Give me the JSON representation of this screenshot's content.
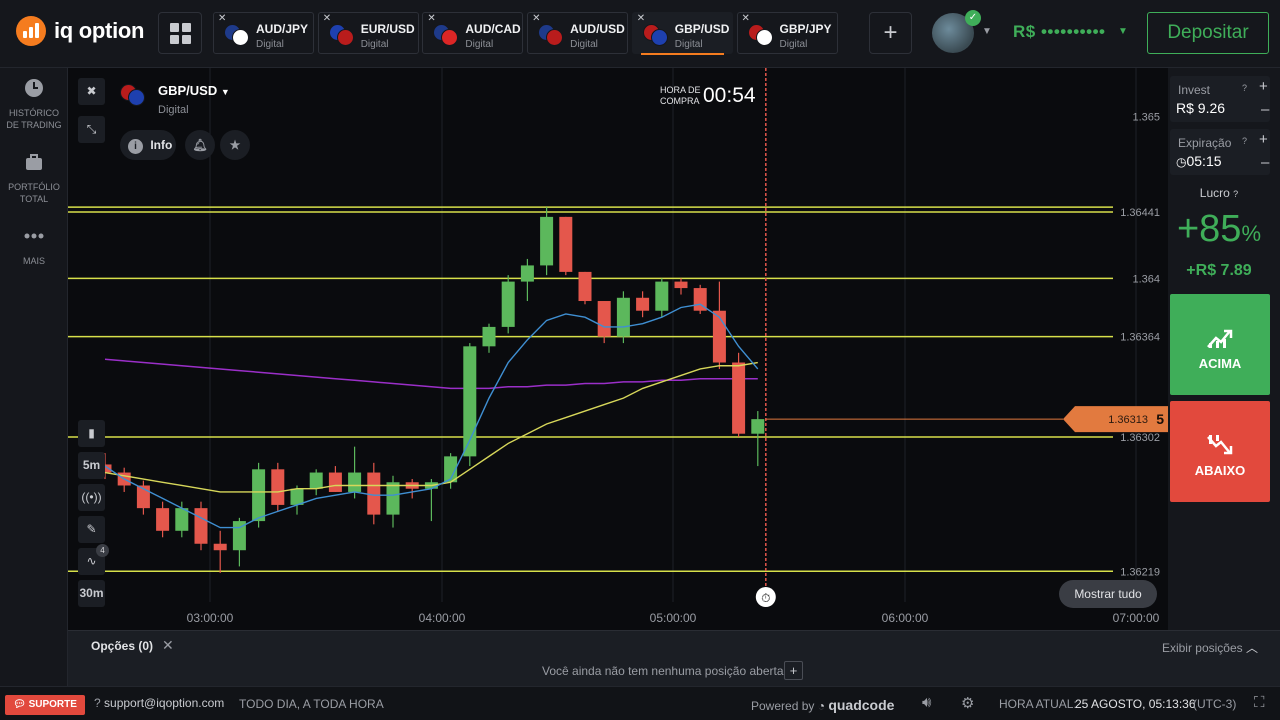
{
  "header": {
    "logo_text": "iq option",
    "tabs": [
      {
        "symbol": "AUD/JPY",
        "type": "Digital",
        "flag_a": "#1e3a8a",
        "flag_b": "#ffffff",
        "active": false
      },
      {
        "symbol": "EUR/USD",
        "type": "Digital",
        "flag_a": "#1e40af",
        "flag_b": "#b91c1c",
        "active": false
      },
      {
        "symbol": "AUD/CAD",
        "type": "Digital",
        "flag_a": "#1e3a8a",
        "flag_b": "#dc2626",
        "active": false
      },
      {
        "symbol": "AUD/USD",
        "type": "Digital",
        "flag_a": "#1e3a8a",
        "flag_b": "#b91c1c",
        "active": false
      },
      {
        "symbol": "GBP/USD",
        "type": "Digital",
        "flag_a": "#b91c1c",
        "flag_b": "#1e40af",
        "active": true
      },
      {
        "symbol": "GBP/JPY",
        "type": "Digital",
        "flag_a": "#b91c1c",
        "flag_b": "#ffffff",
        "active": false
      }
    ],
    "add_tab": "+",
    "balance": "R$ ••••••••••",
    "deposit": "Depositar"
  },
  "sidebar": {
    "items": [
      {
        "label_1": "HISTÓRICO",
        "label_2": "DE TRADING",
        "icon": "clock-icon"
      },
      {
        "label_1": "PORTFÓLIO",
        "label_2": "TOTAL",
        "icon": "briefcase-icon"
      },
      {
        "label_1": "MAIS",
        "label_2": "",
        "icon": "more-icon"
      }
    ]
  },
  "chart": {
    "asset": "GBP/USD",
    "asset_type": "Digital",
    "info_label": "Info",
    "hora_label_1": "HORA DE",
    "hora_label_2": "COMPRA",
    "timer": "00:54",
    "current_price_main": "1.36313",
    "current_price_tail": "5",
    "show_all": "Mostrar tudo",
    "timeframe": "5m",
    "period": "30m",
    "indicator_count": "4",
    "colors": {
      "up": "#5cb85c",
      "down": "#e4574c",
      "level": "#d7e04a",
      "ma_fast": "#3f8fd2",
      "ma_slow": "#d7d75a",
      "ma_long": "#9b2fc9",
      "cursor": "#e4574c"
    }
  },
  "chart_data": {
    "type": "candlestick",
    "y_ticks": [
      "1.365",
      "1.36441",
      "1.364",
      "1.36364",
      "1.36302",
      "1.36219"
    ],
    "x_ticks": [
      "03:00:00",
      "04:00:00",
      "05:00:00",
      "06:00:00",
      "07:00:00"
    ],
    "levels": [
      1.36444,
      1.36441,
      1.364,
      1.36364,
      1.36302,
      1.36219
    ],
    "ylim": [
      1.362,
      1.3653
    ],
    "xlim": [
      "02:30",
      "07:00"
    ],
    "candles": [
      {
        "o": 1.36285,
        "h": 1.36292,
        "l": 1.36276,
        "c": 1.3628
      },
      {
        "o": 1.3628,
        "h": 1.36283,
        "l": 1.36268,
        "c": 1.36272
      },
      {
        "o": 1.36272,
        "h": 1.36275,
        "l": 1.36254,
        "c": 1.36258
      },
      {
        "o": 1.36258,
        "h": 1.36262,
        "l": 1.3624,
        "c": 1.36244
      },
      {
        "o": 1.36244,
        "h": 1.36262,
        "l": 1.3624,
        "c": 1.36258
      },
      {
        "o": 1.36258,
        "h": 1.36262,
        "l": 1.36232,
        "c": 1.36236
      },
      {
        "o": 1.36236,
        "h": 1.36244,
        "l": 1.36218,
        "c": 1.36232
      },
      {
        "o": 1.36232,
        "h": 1.36252,
        "l": 1.36222,
        "c": 1.3625
      },
      {
        "o": 1.3625,
        "h": 1.36286,
        "l": 1.36246,
        "c": 1.36282
      },
      {
        "o": 1.36282,
        "h": 1.36286,
        "l": 1.36256,
        "c": 1.3626
      },
      {
        "o": 1.3626,
        "h": 1.36272,
        "l": 1.36254,
        "c": 1.3627
      },
      {
        "o": 1.3627,
        "h": 1.36282,
        "l": 1.36266,
        "c": 1.3628
      },
      {
        "o": 1.3628,
        "h": 1.36284,
        "l": 1.36268,
        "c": 1.36268
      },
      {
        "o": 1.36268,
        "h": 1.36296,
        "l": 1.36264,
        "c": 1.3628
      },
      {
        "o": 1.3628,
        "h": 1.36286,
        "l": 1.36248,
        "c": 1.36254
      },
      {
        "o": 1.36254,
        "h": 1.36278,
        "l": 1.36246,
        "c": 1.36274
      },
      {
        "o": 1.36274,
        "h": 1.36276,
        "l": 1.36264,
        "c": 1.3627
      },
      {
        "o": 1.3627,
        "h": 1.36276,
        "l": 1.3625,
        "c": 1.36274
      },
      {
        "o": 1.36274,
        "h": 1.36292,
        "l": 1.3627,
        "c": 1.3629
      },
      {
        "o": 1.3629,
        "h": 1.3636,
        "l": 1.36284,
        "c": 1.36358
      },
      {
        "o": 1.36358,
        "h": 1.36372,
        "l": 1.36354,
        "c": 1.3637
      },
      {
        "o": 1.3637,
        "h": 1.36402,
        "l": 1.36366,
        "c": 1.36398
      },
      {
        "o": 1.36398,
        "h": 1.36412,
        "l": 1.36386,
        "c": 1.36408
      },
      {
        "o": 1.36408,
        "h": 1.36444,
        "l": 1.36402,
        "c": 1.36438
      },
      {
        "o": 1.36438,
        "h": 1.36438,
        "l": 1.36402,
        "c": 1.36404
      },
      {
        "o": 1.36404,
        "h": 1.36404,
        "l": 1.36384,
        "c": 1.36386
      },
      {
        "o": 1.36386,
        "h": 1.36386,
        "l": 1.3636,
        "c": 1.36364
      },
      {
        "o": 1.36364,
        "h": 1.36392,
        "l": 1.3636,
        "c": 1.36388
      },
      {
        "o": 1.36388,
        "h": 1.36392,
        "l": 1.36376,
        "c": 1.3638
      },
      {
        "o": 1.3638,
        "h": 1.364,
        "l": 1.36376,
        "c": 1.36398
      },
      {
        "o": 1.36398,
        "h": 1.364,
        "l": 1.3639,
        "c": 1.36394
      },
      {
        "o": 1.36394,
        "h": 1.36396,
        "l": 1.36378,
        "c": 1.3638
      },
      {
        "o": 1.3638,
        "h": 1.36398,
        "l": 1.36344,
        "c": 1.36348
      },
      {
        "o": 1.36348,
        "h": 1.36354,
        "l": 1.36302,
        "c": 1.36304
      },
      {
        "o": 1.36304,
        "h": 1.36318,
        "l": 1.36284,
        "c": 1.36313
      }
    ],
    "ma_fast": [
      1.36284,
      1.36276,
      1.3627,
      1.36264,
      1.36258,
      1.36252,
      1.36246,
      1.36246,
      1.36252,
      1.36256,
      1.3626,
      1.36264,
      1.36266,
      1.36268,
      1.36266,
      1.36266,
      1.36268,
      1.3627,
      1.36276,
      1.363,
      1.36326,
      1.36348,
      1.36362,
      1.36374,
      1.36378,
      1.36376,
      1.3637,
      1.3637,
      1.36372,
      1.36376,
      1.36382,
      1.36384,
      1.36376,
      1.36358,
      1.36344
    ],
    "ma_slow": [
      1.3628,
      1.36278,
      1.36276,
      1.36274,
      1.36272,
      1.3627,
      1.36268,
      1.36268,
      1.36268,
      1.36268,
      1.3627,
      1.3627,
      1.36272,
      1.36272,
      1.36272,
      1.36272,
      1.36272,
      1.36272,
      1.36274,
      1.36282,
      1.3629,
      1.36298,
      1.36304,
      1.3631,
      1.36314,
      1.36318,
      1.36322,
      1.36326,
      1.36332,
      1.36336,
      1.3634,
      1.36344,
      1.36346,
      1.36346,
      1.36348
    ],
    "ma_long": [
      1.3635,
      1.36349,
      1.36348,
      1.36347,
      1.36346,
      1.36345,
      1.36344,
      1.36343,
      1.36342,
      1.36341,
      1.3634,
      1.36339,
      1.36338,
      1.36337,
      1.36336,
      1.36335,
      1.36334,
      1.36333,
      1.36332,
      1.36332,
      1.36332,
      1.36333,
      1.36333,
      1.36334,
      1.36334,
      1.36335,
      1.36335,
      1.36336,
      1.36336,
      1.36337,
      1.36337,
      1.36338,
      1.36338,
      1.36338,
      1.36338
    ]
  },
  "trade_panel": {
    "invest_label": "Invest",
    "invest_value": "R$ 9.26",
    "expiration_label": "Expiração",
    "expiration_value": "05:15",
    "profit_label": "Lucro",
    "profit_percent": "+85",
    "profit_percent_sign": "%",
    "profit_value": "+R$ 7.89",
    "up_label": "ACIMA",
    "down_label": "ABAIXO"
  },
  "options_bar": {
    "title": "Opções (0)",
    "show_positions": "Exibir posições",
    "empty_message": "Você ainda não tem nenhuma posição aberta"
  },
  "footer": {
    "support_button": "SUPORTE",
    "email": "support@iqoption.com",
    "hours": "TODO DIA, A TODA HORA",
    "powered_by": "Powered by",
    "powered_brand": "quadcode",
    "time_label": "HORA ATUAL:",
    "time_value": "25 AGOSTO, 05:13:36",
    "timezone": "(UTC-3)"
  }
}
